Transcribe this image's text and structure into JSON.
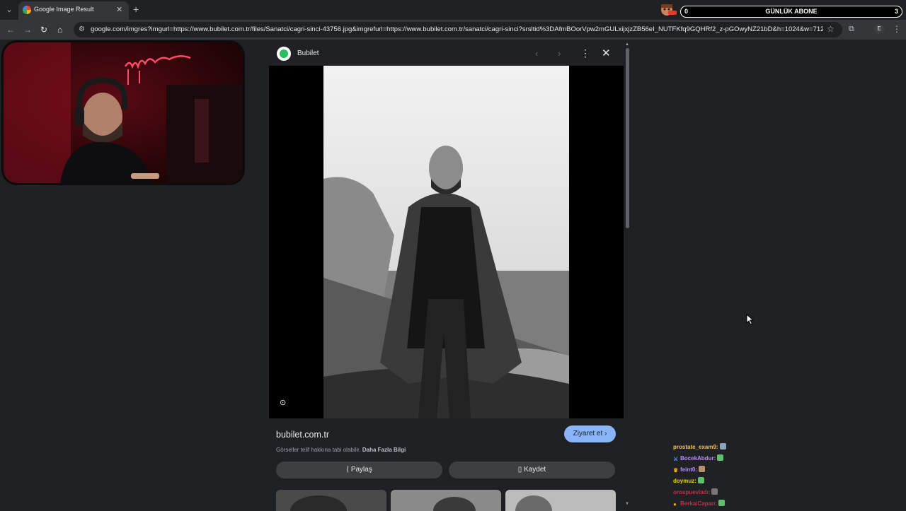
{
  "browser": {
    "tab_title": "Google Image Result",
    "url": "google.com/imgres?imgurl=https://www.bubilet.com.tr/files/Sanatci/cagri-sinci-43756.jpg&imgrefurl=https://www.bubilet.com.tr/sanatci/cagri-sinci?srsltid%3DAfmBOorVpw2mGULxijxjzZB56eI_NUTFKfq9GQHRf2_z-pGOwyNZ21bD&h=1024&w=712...",
    "profile_initial": "E"
  },
  "overlay": {
    "sub_left": "0",
    "sub_title": "GÜNLÜK ABONE",
    "sub_right": "3"
  },
  "panel": {
    "source_name": "Bubilet",
    "domain": "bubilet.com.tr",
    "visit_label": "Ziyaret et",
    "copyright_text": "Görseller telif hakkına tabi olabilir.",
    "copyright_link": "Daha Fazla Bilgi",
    "share_label": "Paylaş",
    "save_label": "Kaydet"
  },
  "chat": [
    {
      "user": "prostate_exam9:",
      "color": "#f0c060"
    },
    {
      "user": "BocekAbdur:",
      "color": "#b48cff"
    },
    {
      "user": "feint0:",
      "color": "#b48cff"
    },
    {
      "user": "doymuz:",
      "color": "#e6d200"
    },
    {
      "user": "orospuevladı:",
      "color": "#c0304a"
    },
    {
      "user": "BerkaiCaparı:",
      "color": "#c0304a"
    }
  ],
  "colors": {
    "accent": "#8ab4f8",
    "page_bg": "#202124"
  }
}
